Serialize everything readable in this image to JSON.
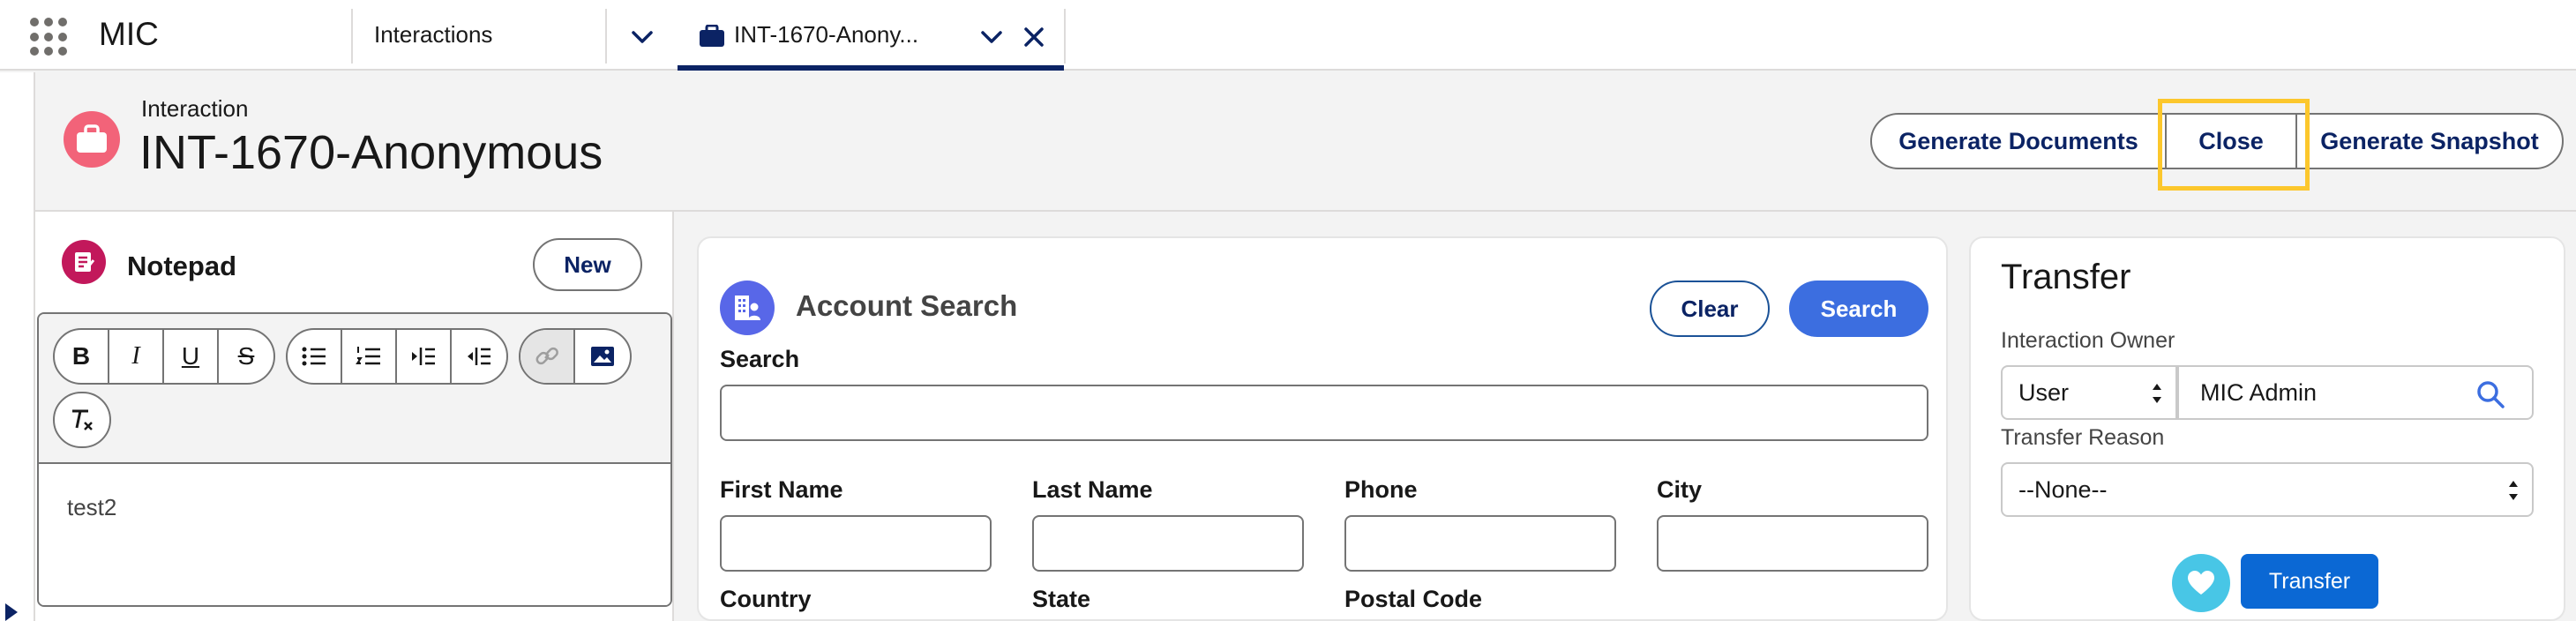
{
  "topbar": {
    "app_name": "MIC",
    "nav_item": "Interactions",
    "active_tab_label": "INT-1670-Anony..."
  },
  "record": {
    "type": "Interaction",
    "title": "INT-1670-Anonymous",
    "actions": {
      "generate_documents": "Generate Documents",
      "close": "Close",
      "generate_snapshot": "Generate Snapshot"
    }
  },
  "notepad": {
    "title": "Notepad",
    "new_label": "New",
    "toolbar": {
      "bold": "B",
      "italic": "I",
      "underline": "U",
      "strike": "S"
    },
    "content": "test2"
  },
  "account_search": {
    "title": "Account Search",
    "clear_label": "Clear",
    "search_label": "Search",
    "search_field_label": "Search",
    "search_value": "",
    "fields": {
      "first_name": "First Name",
      "last_name": "Last Name",
      "phone": "Phone",
      "city": "City",
      "country": "Country",
      "state": "State",
      "postal_code": "Postal Code"
    }
  },
  "transfer": {
    "title": "Transfer",
    "owner_label": "Interaction Owner",
    "owner_type": "User",
    "owner_value": "MIC Admin",
    "reason_label": "Transfer Reason",
    "reason_value": "--None--",
    "button_label": "Transfer"
  },
  "colors": {
    "accent_navy": "#0b2364",
    "interaction_icon": "#f26379",
    "notepad_icon": "#c2185b",
    "account_icon": "#5867e8",
    "search_button": "#3c6ee0",
    "transfer_button": "#0b68d4",
    "highlight": "#fcc72c"
  }
}
